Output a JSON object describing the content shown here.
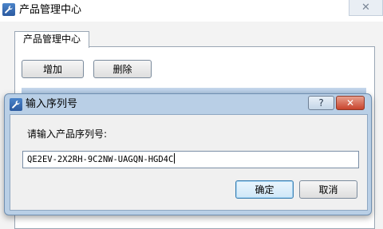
{
  "main_window": {
    "title": "产品管理中心",
    "close_glyph": "✕",
    "tab_label": "产品管理中心",
    "add_label": "增加",
    "delete_label": "删除"
  },
  "dialog": {
    "title": "输入序列号",
    "help_glyph": "?",
    "close_glyph": "✕",
    "prompt": "请输入产品序列号:",
    "serial_value": "QE2EV-2X2RH-9C2NW-UAGQN-HGD4C",
    "confirm_label": "确定",
    "cancel_label": "取消"
  },
  "icons": {
    "app": "wrench-icon",
    "dialog": "wrench-icon"
  },
  "colors": {
    "title_accent": "#2b5aa0",
    "dialog_frame": "#b9cfe6",
    "close_red": "#c8432c"
  }
}
